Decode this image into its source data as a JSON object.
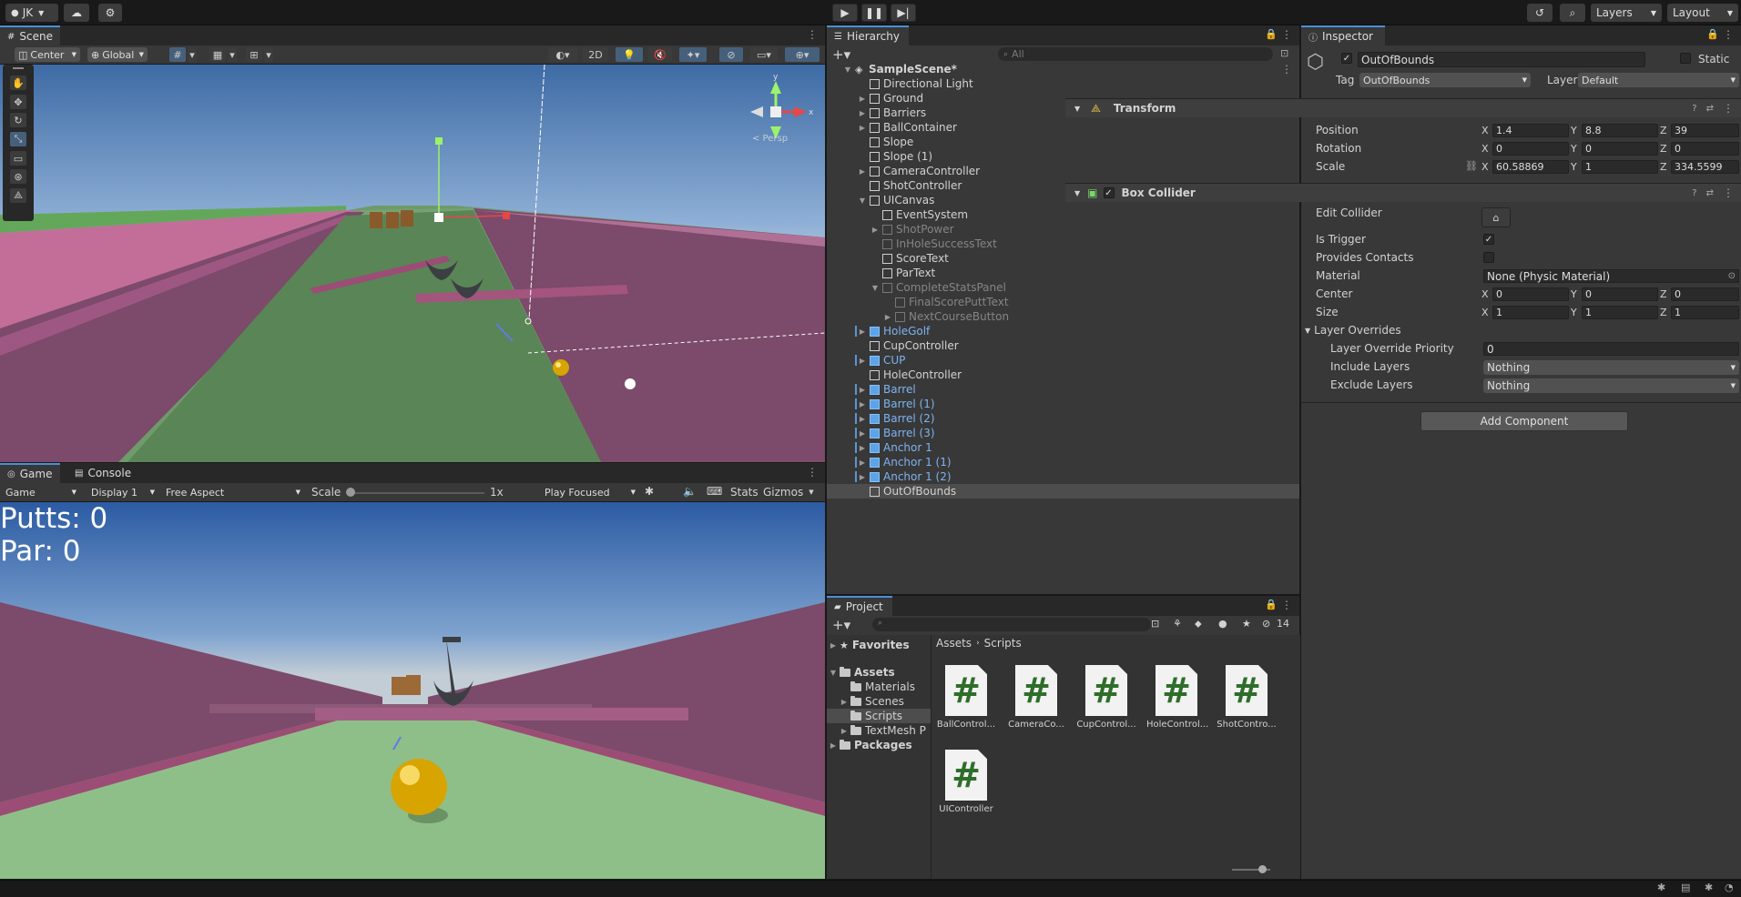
{
  "topbar": {
    "account": "JK",
    "layers": "Layers",
    "layout": "Layout"
  },
  "scene": {
    "tab": "Scene",
    "pivot": "Center",
    "space": "Global",
    "mode2d": "2D",
    "gizmo_label": "< Persp"
  },
  "game": {
    "tab_game": "Game",
    "tab_console": "Console",
    "display_mode": "Game",
    "display": "Display 1",
    "aspect": "Free Aspect",
    "scale_label": "Scale",
    "scale_value": "1x",
    "play_mode": "Play Focused",
    "stats": "Stats",
    "gizmos": "Gizmos",
    "putts": "Putts: 0",
    "par": "Par: 0"
  },
  "hierarchy": {
    "tab": "Hierarchy",
    "search_placeholder": "All",
    "items": [
      {
        "label": "SampleScene*",
        "depth": 0,
        "arrow": "▼",
        "type": "scene"
      },
      {
        "label": "Directional Light",
        "depth": 1,
        "arrow": "",
        "type": "go"
      },
      {
        "label": "Ground",
        "depth": 1,
        "arrow": "▶",
        "type": "go"
      },
      {
        "label": "Barriers",
        "depth": 1,
        "arrow": "▶",
        "type": "go"
      },
      {
        "label": "BallContainer",
        "depth": 1,
        "arrow": "▶",
        "type": "go"
      },
      {
        "label": "Slope",
        "depth": 1,
        "arrow": "",
        "type": "go"
      },
      {
        "label": "Slope (1)",
        "depth": 1,
        "arrow": "",
        "type": "go"
      },
      {
        "label": "CameraController",
        "depth": 1,
        "arrow": "▶",
        "type": "go"
      },
      {
        "label": "ShotController",
        "depth": 1,
        "arrow": "",
        "type": "go"
      },
      {
        "label": "UICanvas",
        "depth": 1,
        "arrow": "▼",
        "type": "go"
      },
      {
        "label": "EventSystem",
        "depth": 2,
        "arrow": "",
        "type": "go"
      },
      {
        "label": "ShotPower",
        "depth": 2,
        "arrow": "▶",
        "type": "dim"
      },
      {
        "label": "InHoleSuccessText",
        "depth": 2,
        "arrow": "",
        "type": "dim"
      },
      {
        "label": "ScoreText",
        "depth": 2,
        "arrow": "",
        "type": "go"
      },
      {
        "label": "ParText",
        "depth": 2,
        "arrow": "",
        "type": "go"
      },
      {
        "label": "CompleteStatsPanel",
        "depth": 2,
        "arrow": "▼",
        "type": "dim"
      },
      {
        "label": "FinalScorePuttText",
        "depth": 3,
        "arrow": "",
        "type": "dim"
      },
      {
        "label": "NextCourseButton",
        "depth": 3,
        "arrow": "▶",
        "type": "dim"
      },
      {
        "label": "HoleGolf",
        "depth": 1,
        "arrow": "▶",
        "type": "prefab"
      },
      {
        "label": "CupController",
        "depth": 1,
        "arrow": "",
        "type": "go"
      },
      {
        "label": "CUP",
        "depth": 1,
        "arrow": "▶",
        "type": "prefab"
      },
      {
        "label": "HoleController",
        "depth": 1,
        "arrow": "",
        "type": "go"
      },
      {
        "label": "Barrel",
        "depth": 1,
        "arrow": "▶",
        "type": "prefab"
      },
      {
        "label": "Barrel (1)",
        "depth": 1,
        "arrow": "▶",
        "type": "prefab"
      },
      {
        "label": "Barrel (2)",
        "depth": 1,
        "arrow": "▶",
        "type": "prefab"
      },
      {
        "label": "Barrel (3)",
        "depth": 1,
        "arrow": "▶",
        "type": "prefab"
      },
      {
        "label": "Anchor 1",
        "depth": 1,
        "arrow": "▶",
        "type": "prefab"
      },
      {
        "label": "Anchor 1 (1)",
        "depth": 1,
        "arrow": "▶",
        "type": "prefab"
      },
      {
        "label": "Anchor 1 (2)",
        "depth": 1,
        "arrow": "▶",
        "type": "prefab"
      },
      {
        "label": "OutOfBounds",
        "depth": 1,
        "arrow": "",
        "type": "selected"
      }
    ]
  },
  "project": {
    "tab": "Project",
    "hidden_count": "14",
    "breadcrumb_root": "Assets",
    "breadcrumb_current": "Scripts",
    "tree": [
      {
        "label": "Favorites",
        "depth": 0,
        "arrow": "▶",
        "kind": "star"
      },
      {
        "label": "Assets",
        "depth": 0,
        "arrow": "▼",
        "kind": "folder"
      },
      {
        "label": "Materials",
        "depth": 1,
        "arrow": "",
        "kind": "folder"
      },
      {
        "label": "Scenes",
        "depth": 1,
        "arrow": "▶",
        "kind": "folder"
      },
      {
        "label": "Scripts",
        "depth": 1,
        "arrow": "",
        "kind": "folder"
      },
      {
        "label": "TextMesh P",
        "depth": 1,
        "arrow": "▶",
        "kind": "folder"
      },
      {
        "label": "Packages",
        "depth": 0,
        "arrow": "▶",
        "kind": "folder"
      }
    ],
    "files": [
      "BallControl...",
      "CameraCo...",
      "CupControl...",
      "HoleControl...",
      "ShotContro...",
      "UIController"
    ]
  },
  "inspector": {
    "tab": "Inspector",
    "object_name": "OutOfBounds",
    "static_label": "Static",
    "tag_label": "Tag",
    "tag_value": "OutOfBounds",
    "layer_label": "Layer",
    "layer_value": "Default",
    "transform": {
      "title": "Transform",
      "position_label": "Position",
      "rotation_label": "Rotation",
      "scale_label": "Scale",
      "position": [
        "1.4",
        "8.8",
        "39"
      ],
      "rotation": [
        "0",
        "0",
        "0"
      ],
      "scale": [
        "60.58869",
        "1",
        "334.5599"
      ]
    },
    "box_collider": {
      "title": "Box Collider",
      "edit_collider": "Edit Collider",
      "is_trigger": "Is Trigger",
      "provides_contacts": "Provides Contacts",
      "material_label": "Material",
      "material_value": "None (Physic Material)",
      "center_label": "Center",
      "size_label": "Size",
      "center": [
        "0",
        "0",
        "0"
      ],
      "size": [
        "1",
        "1",
        "1"
      ],
      "layer_overrides": "Layer Overrides",
      "priority_label": "Layer Override Priority",
      "priority_value": "0",
      "include_label": "Include Layers",
      "include_value": "Nothing",
      "exclude_label": "Exclude Layers",
      "exclude_value": "Nothing"
    },
    "add_component": "Add Component",
    "axis_x": "X",
    "axis_y": "Y",
    "axis_z": "Z"
  }
}
